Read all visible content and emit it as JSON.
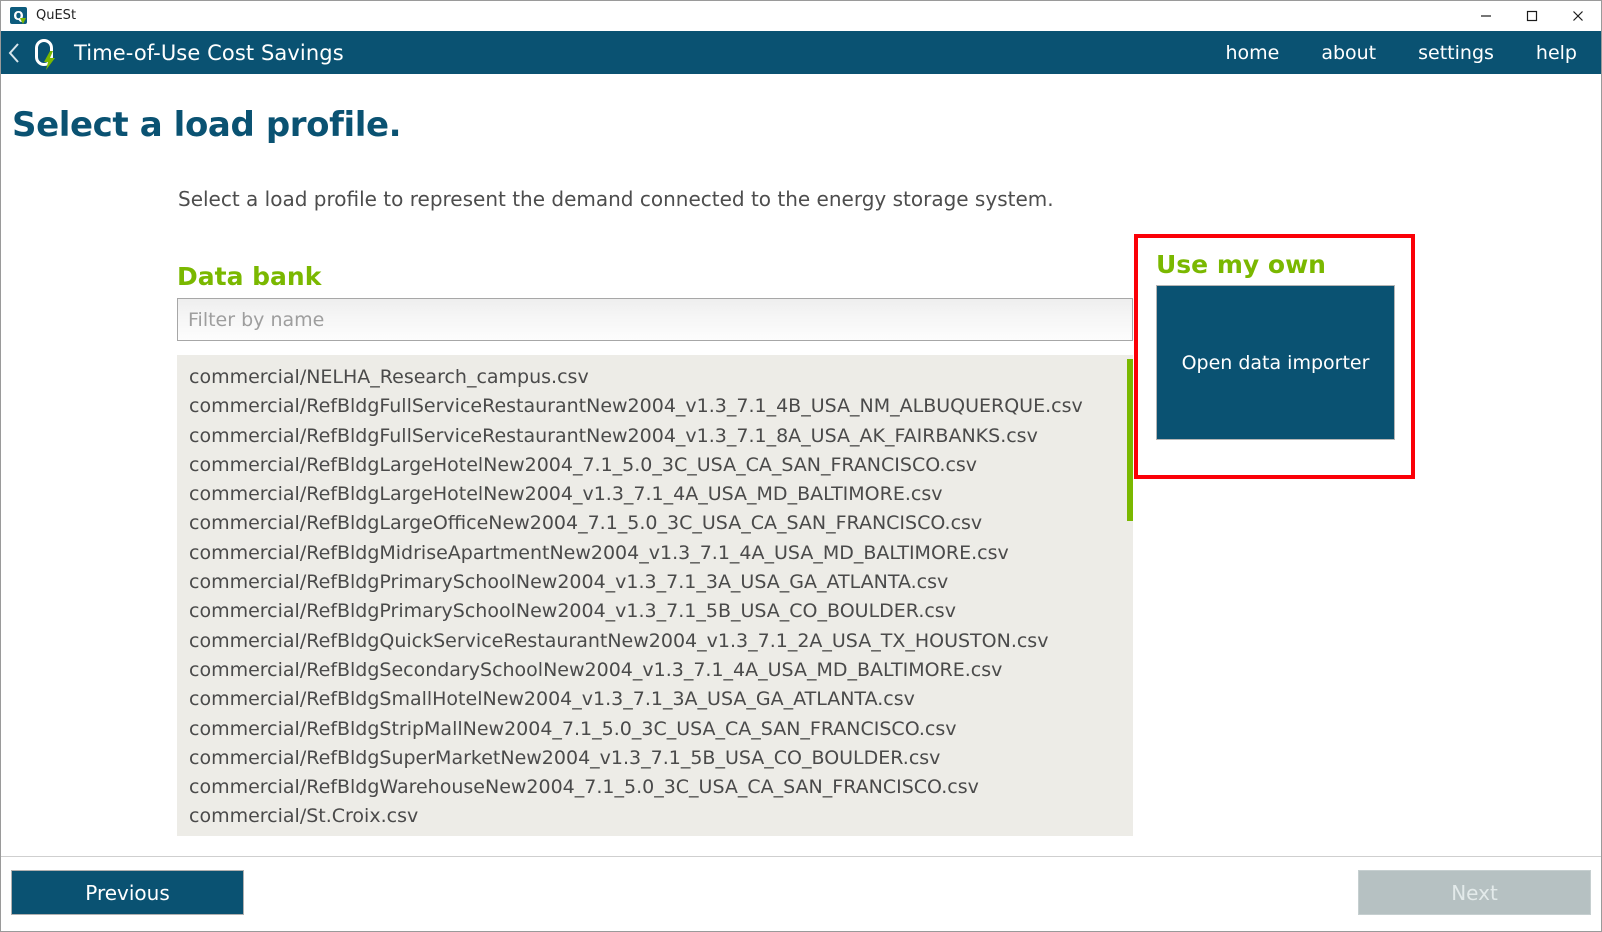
{
  "window": {
    "title": "QuESt",
    "app_icon": "quest-logo-icon",
    "controls": {
      "minimize": "minimize-icon",
      "maximize": "maximize-icon",
      "close": "close-icon"
    }
  },
  "appbar": {
    "back_icon": "chevron-left-icon",
    "logo_icon": "quest-logo-icon",
    "title": "Time-of-Use Cost Savings",
    "nav": [
      {
        "label": "home"
      },
      {
        "label": "about"
      },
      {
        "label": "settings"
      },
      {
        "label": "help"
      }
    ]
  },
  "page": {
    "title": "Select a load profile.",
    "description": "Select a load profile to represent the demand connected to the energy storage system."
  },
  "databank": {
    "heading": "Data bank",
    "filter": {
      "placeholder": "Filter by name",
      "value": ""
    },
    "items": [
      "commercial/NELHA_Research_campus.csv",
      "commercial/RefBldgFullServiceRestaurantNew2004_v1.3_7.1_4B_USA_NM_ALBUQUERQUE.csv",
      "commercial/RefBldgFullServiceRestaurantNew2004_v1.3_7.1_8A_USA_AK_FAIRBANKS.csv",
      "commercial/RefBldgLargeHotelNew2004_7.1_5.0_3C_USA_CA_SAN_FRANCISCO.csv",
      "commercial/RefBldgLargeHotelNew2004_v1.3_7.1_4A_USA_MD_BALTIMORE.csv",
      "commercial/RefBldgLargeOfficeNew2004_7.1_5.0_3C_USA_CA_SAN_FRANCISCO.csv",
      "commercial/RefBldgMidriseApartmentNew2004_v1.3_7.1_4A_USA_MD_BALTIMORE.csv",
      "commercial/RefBldgPrimarySchoolNew2004_v1.3_7.1_3A_USA_GA_ATLANTA.csv",
      "commercial/RefBldgPrimarySchoolNew2004_v1.3_7.1_5B_USA_CO_BOULDER.csv",
      "commercial/RefBldgQuickServiceRestaurantNew2004_v1.3_7.1_2A_USA_TX_HOUSTON.csv",
      "commercial/RefBldgSecondarySchoolNew2004_v1.3_7.1_4A_USA_MD_BALTIMORE.csv",
      "commercial/RefBldgSmallHotelNew2004_v1.3_7.1_3A_USA_GA_ATLANTA.csv",
      "commercial/RefBldgStripMallNew2004_7.1_5.0_3C_USA_CA_SAN_FRANCISCO.csv",
      "commercial/RefBldgSuperMarketNew2004_v1.3_7.1_5B_USA_CO_BOULDER.csv",
      "commercial/RefBldgWarehouseNew2004_7.1_5.0_3C_USA_CA_SAN_FRANCISCO.csv",
      "commercial/St.Croix.csv"
    ]
  },
  "useown": {
    "heading": "Use my own",
    "importer_button": "Open data importer",
    "highlight_color": "#fb0007"
  },
  "footer": {
    "previous": "Previous",
    "next": "Next"
  },
  "colors": {
    "brand_blue": "#0a5272",
    "brand_green": "#7ab800",
    "list_background": "#edece7",
    "disabled_gray": "#b6c1c2"
  }
}
